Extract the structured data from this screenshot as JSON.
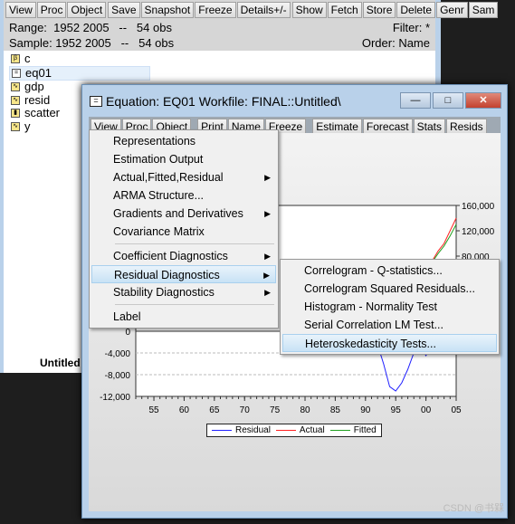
{
  "workfile": {
    "toolbar": [
      "View",
      "Proc",
      "Object",
      "Save",
      "Snapshot",
      "Freeze",
      "Details+/-",
      "Show",
      "Fetch",
      "Store",
      "Delete",
      "Genr",
      "Sam"
    ],
    "range": "Range:  1952 2005   --   54 obs",
    "sample": "Sample: 1952 2005   --   54 obs",
    "filter": "Filter: *",
    "order": "Order: Name",
    "objects": [
      {
        "name": "c",
        "icon": "coef-icon"
      },
      {
        "name": "eq01",
        "icon": "equation-icon",
        "selected": true
      },
      {
        "name": "gdp",
        "icon": "series-icon"
      },
      {
        "name": "resid",
        "icon": "series-icon"
      },
      {
        "name": "scatter",
        "icon": "graph-icon"
      },
      {
        "name": "y",
        "icon": "series-icon"
      }
    ],
    "tab": "Untitled"
  },
  "equation": {
    "title": "Equation: EQ01   Workfile: FINAL::Untitled\\",
    "toolbar": [
      "View",
      "Proc",
      "Object",
      "Print",
      "Name",
      "Freeze",
      "Estimate",
      "Forecast",
      "Stats",
      "Resids"
    ],
    "view_menu": [
      "Representations",
      "Estimation Output",
      "Actual,Fitted,Residual",
      "ARMA Structure...",
      "Gradients and Derivatives",
      "Covariance Matrix",
      "Coefficient Diagnostics",
      "Residual Diagnostics",
      "Stability Diagnostics",
      "Label"
    ],
    "submenu": [
      "Correlogram - Q-statistics...",
      "Correlogram Squared Residuals...",
      "Histogram - Normality Test",
      "Serial Correlation LM Test...",
      "Heteroskedasticity Tests..."
    ],
    "highlighted": "Residual Diagnostics",
    "sub_highlighted": "Heteroskedasticity Tests..."
  },
  "chart_data": {
    "type": "line",
    "x_ticks": [
      "55",
      "60",
      "65",
      "70",
      "75",
      "80",
      "85",
      "90",
      "95",
      "00",
      "05"
    ],
    "left_ticks": [
      "0",
      "-4,000",
      "-8,000",
      "-12,000"
    ],
    "right_ticks": [
      "160,000",
      "120,000",
      "80,000"
    ],
    "x": [
      1991,
      1992,
      1993,
      1994,
      1995,
      1996,
      1997,
      1998,
      1999,
      2000,
      2001,
      2002,
      2003,
      2004,
      2005
    ],
    "series": [
      {
        "name": "Residual",
        "color": "#2020ff",
        "axis": "left",
        "values": [
          -1000,
          -2500,
          -6000,
          -10200,
          -11000,
          -9500,
          -7000,
          -4000,
          -2500,
          -4500,
          -2500,
          null,
          null,
          null,
          null
        ]
      },
      {
        "name": "Actual",
        "color": "#ff2020",
        "axis": "right",
        "values": [
          null,
          null,
          null,
          null,
          null,
          null,
          null,
          null,
          null,
          60000,
          72000,
          88000,
          100000,
          120000,
          140000
        ]
      },
      {
        "name": "Fitted",
        "color": "#20a020",
        "axis": "right",
        "values": [
          null,
          null,
          null,
          null,
          null,
          null,
          null,
          null,
          null,
          58000,
          70000,
          84000,
          96000,
          112000,
          130000
        ]
      }
    ],
    "left_ylim": [
      -12000,
      4000
    ],
    "right_ylim": [
      0,
      160000
    ],
    "grid": "dashed horizontal",
    "legend": "bottom"
  },
  "watermark": "CSDN @书槑"
}
